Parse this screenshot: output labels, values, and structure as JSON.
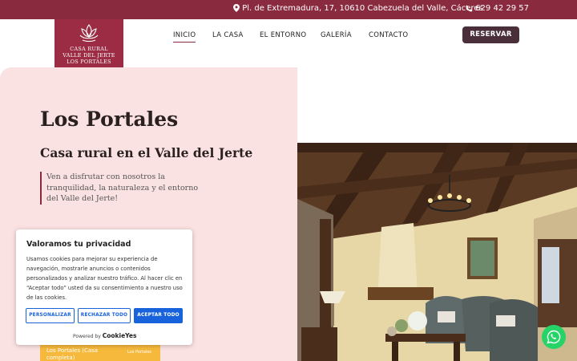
{
  "topbar": {
    "address": "Pl. de Extremadura, 17, 10610 Cabezuela del Valle, Cáceres",
    "phone": "629 42 29 57",
    "address_icon": "map-pin-icon",
    "phone_icon": "phone-icon"
  },
  "logo": {
    "line1": "CASA RURAL",
    "line2": "VALLE DEL JERTE",
    "line3": "LOS PORTALES",
    "icon": "lotus-icon"
  },
  "nav": {
    "items": [
      "INICIO",
      "LA CASA",
      "EL ENTORNO",
      "GALERÍA",
      "CONTACTO"
    ],
    "active": "INICIO",
    "cta": "RESERVAR"
  },
  "hero": {
    "title": "Los Portales",
    "subtitle": "Casa rural en el Valle del Jerte",
    "quote": "Ven a disfrutar con nosotros la tranquilidad, la naturaleza y el entorno del Valle del Jerte!"
  },
  "cookie": {
    "title": "Valoramos tu privacidad",
    "text": "Usamos cookies para mejorar su experiencia de navegación, mostrarle anuncios o contenidos personalizados y analizar nuestro tráfico. Al hacer clic en “Aceptar todo” usted da su consentimiento a nuestro uso de las cookies.",
    "buttons": {
      "customize": "PERSONALIZAR",
      "reject": "RECHAZAR TODO",
      "accept": "ACEPTAR TODO"
    },
    "powered_by": "Powered by",
    "brand": "CookieYes"
  },
  "booking_strip": {
    "property": "Los Portales (Casa completa)",
    "badge": "Los Portales"
  },
  "colors": {
    "brand": "#8a2a3e",
    "logo_bg": "#9b2c44",
    "cta": "#4a2e3a",
    "hero_bg": "#fbe2e2",
    "cookie_blue": "#1863dc",
    "strip": "#f6b93c",
    "whatsapp": "#25d366"
  },
  "whatsapp": {
    "icon": "whatsapp-icon"
  }
}
